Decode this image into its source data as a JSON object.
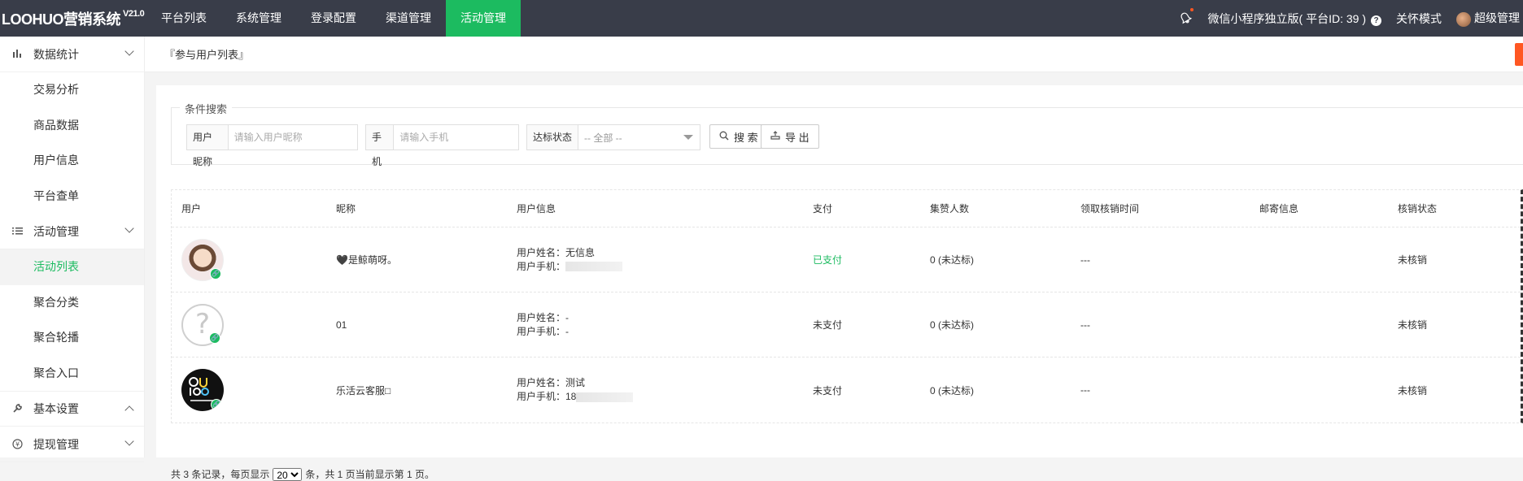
{
  "app": {
    "logo": "LOOHUO营销系统",
    "version": "V21.0"
  },
  "topnav": [
    {
      "label": "平台列表",
      "active": false
    },
    {
      "label": "系统管理",
      "active": false
    },
    {
      "label": "登录配置",
      "active": false
    },
    {
      "label": "渠道管理",
      "active": false
    },
    {
      "label": "活动管理",
      "active": true
    }
  ],
  "topright": {
    "platform": "微信小程序独立版( 平台ID: 39 )",
    "mode": "关怀模式",
    "user": "超级管理"
  },
  "sidebar": {
    "groups": [
      {
        "label": "数据统计",
        "icon": "bar-chart-icon",
        "expanded": true,
        "items": [
          "交易分析",
          "商品数据",
          "用户信息",
          "平台查单"
        ]
      },
      {
        "label": "活动管理",
        "icon": "list-icon",
        "expanded": true,
        "items": [
          "活动列表",
          "聚合分类",
          "聚合轮播",
          "聚合入口"
        ]
      },
      {
        "label": "基本设置",
        "icon": "wrench-icon",
        "expanded": false,
        "items": []
      },
      {
        "label": "提现管理",
        "icon": "coin-icon",
        "expanded": false,
        "items": []
      }
    ],
    "active_item": "活动列表"
  },
  "breadcrumb": "『参与用户列表』",
  "search": {
    "legend": "条件搜索",
    "nickname_label": "用户昵称",
    "nickname_placeholder": "请输入用户昵称",
    "phone_label": "手机",
    "phone_placeholder": "请输入手机",
    "status_label": "达标状态",
    "status_value": "-- 全部 --",
    "search_btn": "搜 索",
    "export_btn": "导 出"
  },
  "table": {
    "headers": [
      "用户",
      "昵称",
      "用户信息",
      "支付",
      "集赞人数",
      "领取核销时间",
      "邮寄信息",
      "核销状态"
    ],
    "rows": [
      {
        "avatar": "girl-avatar",
        "nickname": "🖤是鲸萌呀。",
        "name_line": "用户姓名：无信息",
        "phone_line": "用户手机：",
        "phone_blurred": true,
        "pay": "已支付",
        "paid": true,
        "likes": "0 (未达标)",
        "time": "---",
        "mail": "",
        "state": "未核销"
      },
      {
        "avatar": "question-avatar",
        "nickname": "01",
        "name_line": "用户姓名：-",
        "phone_line": "用户手机：-",
        "phone_blurred": false,
        "pay": "未支付",
        "paid": false,
        "likes": "0 (未达标)",
        "time": "---",
        "mail": "",
        "state": "未核销"
      },
      {
        "avatar": "logo-avatar",
        "nickname": "乐活云客服□",
        "name_line": "用户姓名：测试",
        "phone_line": "用户手机：18",
        "phone_blurred": true,
        "pay": "未支付",
        "paid": false,
        "likes": "0 (未达标)",
        "time": "---",
        "mail": "",
        "state": "未核销"
      }
    ]
  },
  "pager": {
    "prefix": "共 3 条记录，每页显示",
    "page_size": "20",
    "suffix": "条，共 1 页当前显示第 1 页。"
  },
  "colors": {
    "topbar": "#393d49",
    "accent": "#1cbb60",
    "orange": "#ff5722"
  }
}
